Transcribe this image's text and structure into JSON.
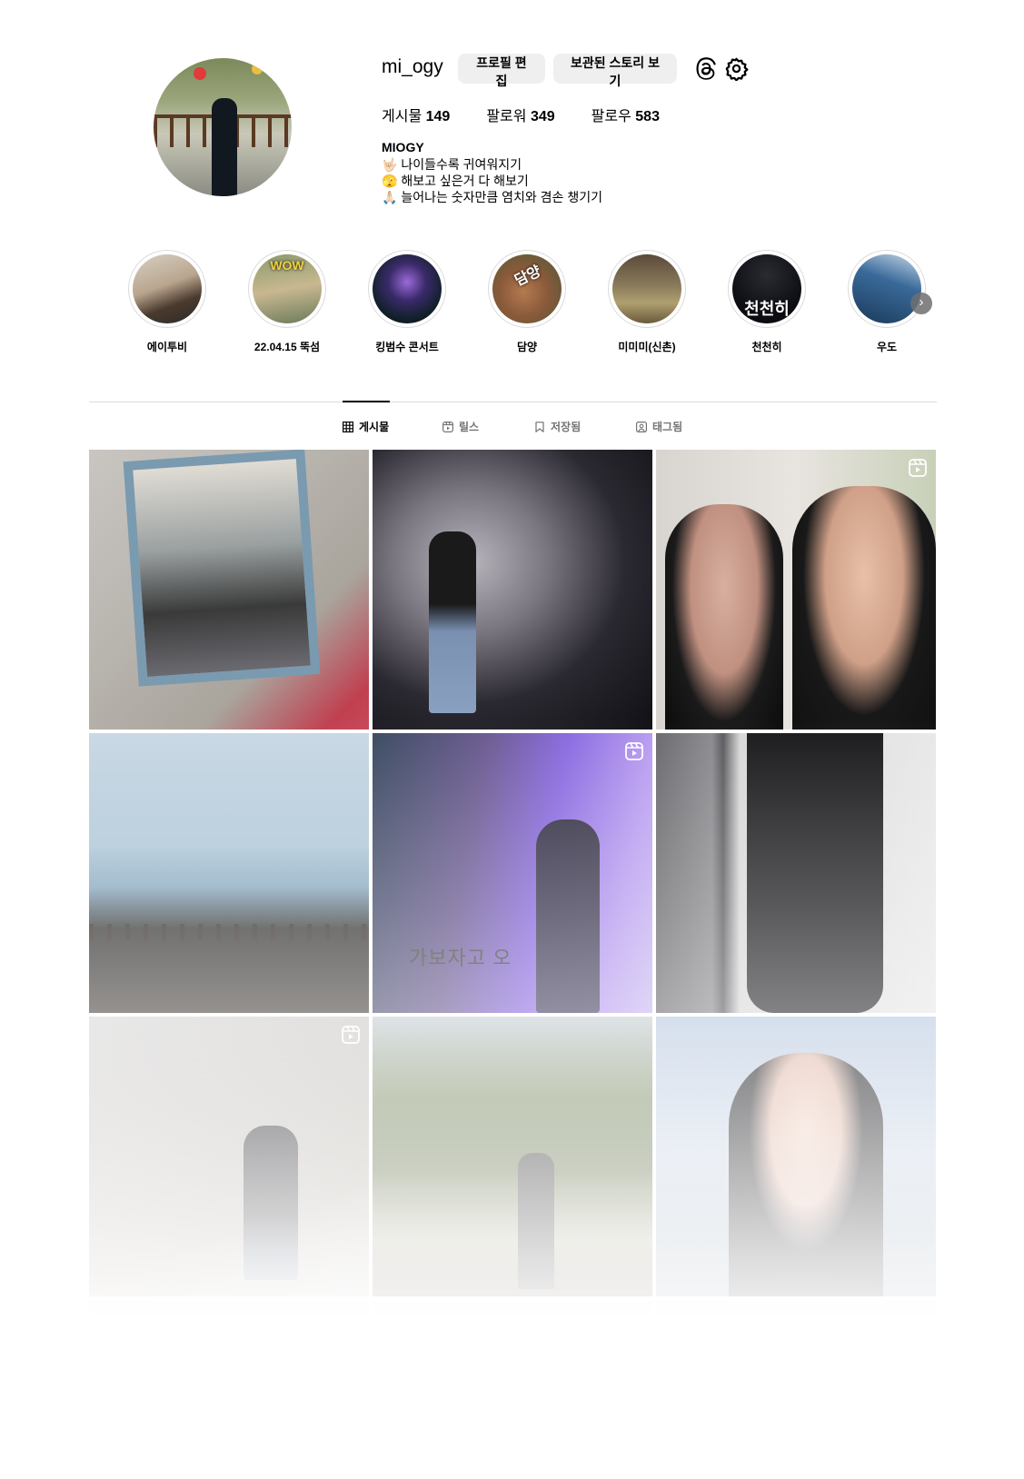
{
  "profile": {
    "username": "mi_ogy",
    "edit_button": "프로필 편집",
    "archive_button": "보관된 스토리 보기",
    "icons": {
      "threads": "threads-icon",
      "settings": "gear-icon"
    },
    "stats": {
      "posts_label": "게시물",
      "posts_value": "149",
      "followers_label": "팔로워",
      "followers_value": "349",
      "following_label": "팔로우",
      "following_value": "583"
    },
    "bio": {
      "name": "MIOGY",
      "lines": [
        "🤟🏻 나이들수록 귀여워지기",
        "🫣 해보고 싶은거 다 해보기",
        "🙏🏻 늘어나는 숫자만큼 염치와 겸손 챙기기"
      ]
    }
  },
  "highlights": [
    {
      "label": "에이투비"
    },
    {
      "label": "22.04.15 뚝섬",
      "overlay": "WOW"
    },
    {
      "label": "킹범수 콘서트"
    },
    {
      "label": "담양",
      "overlay": "담양"
    },
    {
      "label": "미미미(신촌)"
    },
    {
      "label": "천천히",
      "overlay": "천천히"
    },
    {
      "label": "우도"
    }
  ],
  "tabs": [
    {
      "label": "게시물",
      "icon": "grid-icon",
      "active": true
    },
    {
      "label": "릴스",
      "icon": "reels-icon",
      "active": false
    },
    {
      "label": "저장됨",
      "icon": "bookmark-icon",
      "active": false
    },
    {
      "label": "태그됨",
      "icon": "tagged-icon",
      "active": false
    }
  ],
  "posts": [
    {
      "kind": "photo",
      "subject": "mirror selfie"
    },
    {
      "kind": "photo",
      "subject": "wall pose"
    },
    {
      "kind": "reel",
      "subject": "two friends selfie"
    },
    {
      "kind": "photo",
      "subject": "seaside terrace"
    },
    {
      "kind": "reel",
      "subject": "purple lights",
      "caption": "가보자고 오"
    },
    {
      "kind": "photo",
      "subject": "stairs"
    },
    {
      "kind": "reel",
      "subject": "stairway"
    },
    {
      "kind": "photo",
      "subject": "garden"
    },
    {
      "kind": "photo",
      "subject": "portrait"
    }
  ]
}
